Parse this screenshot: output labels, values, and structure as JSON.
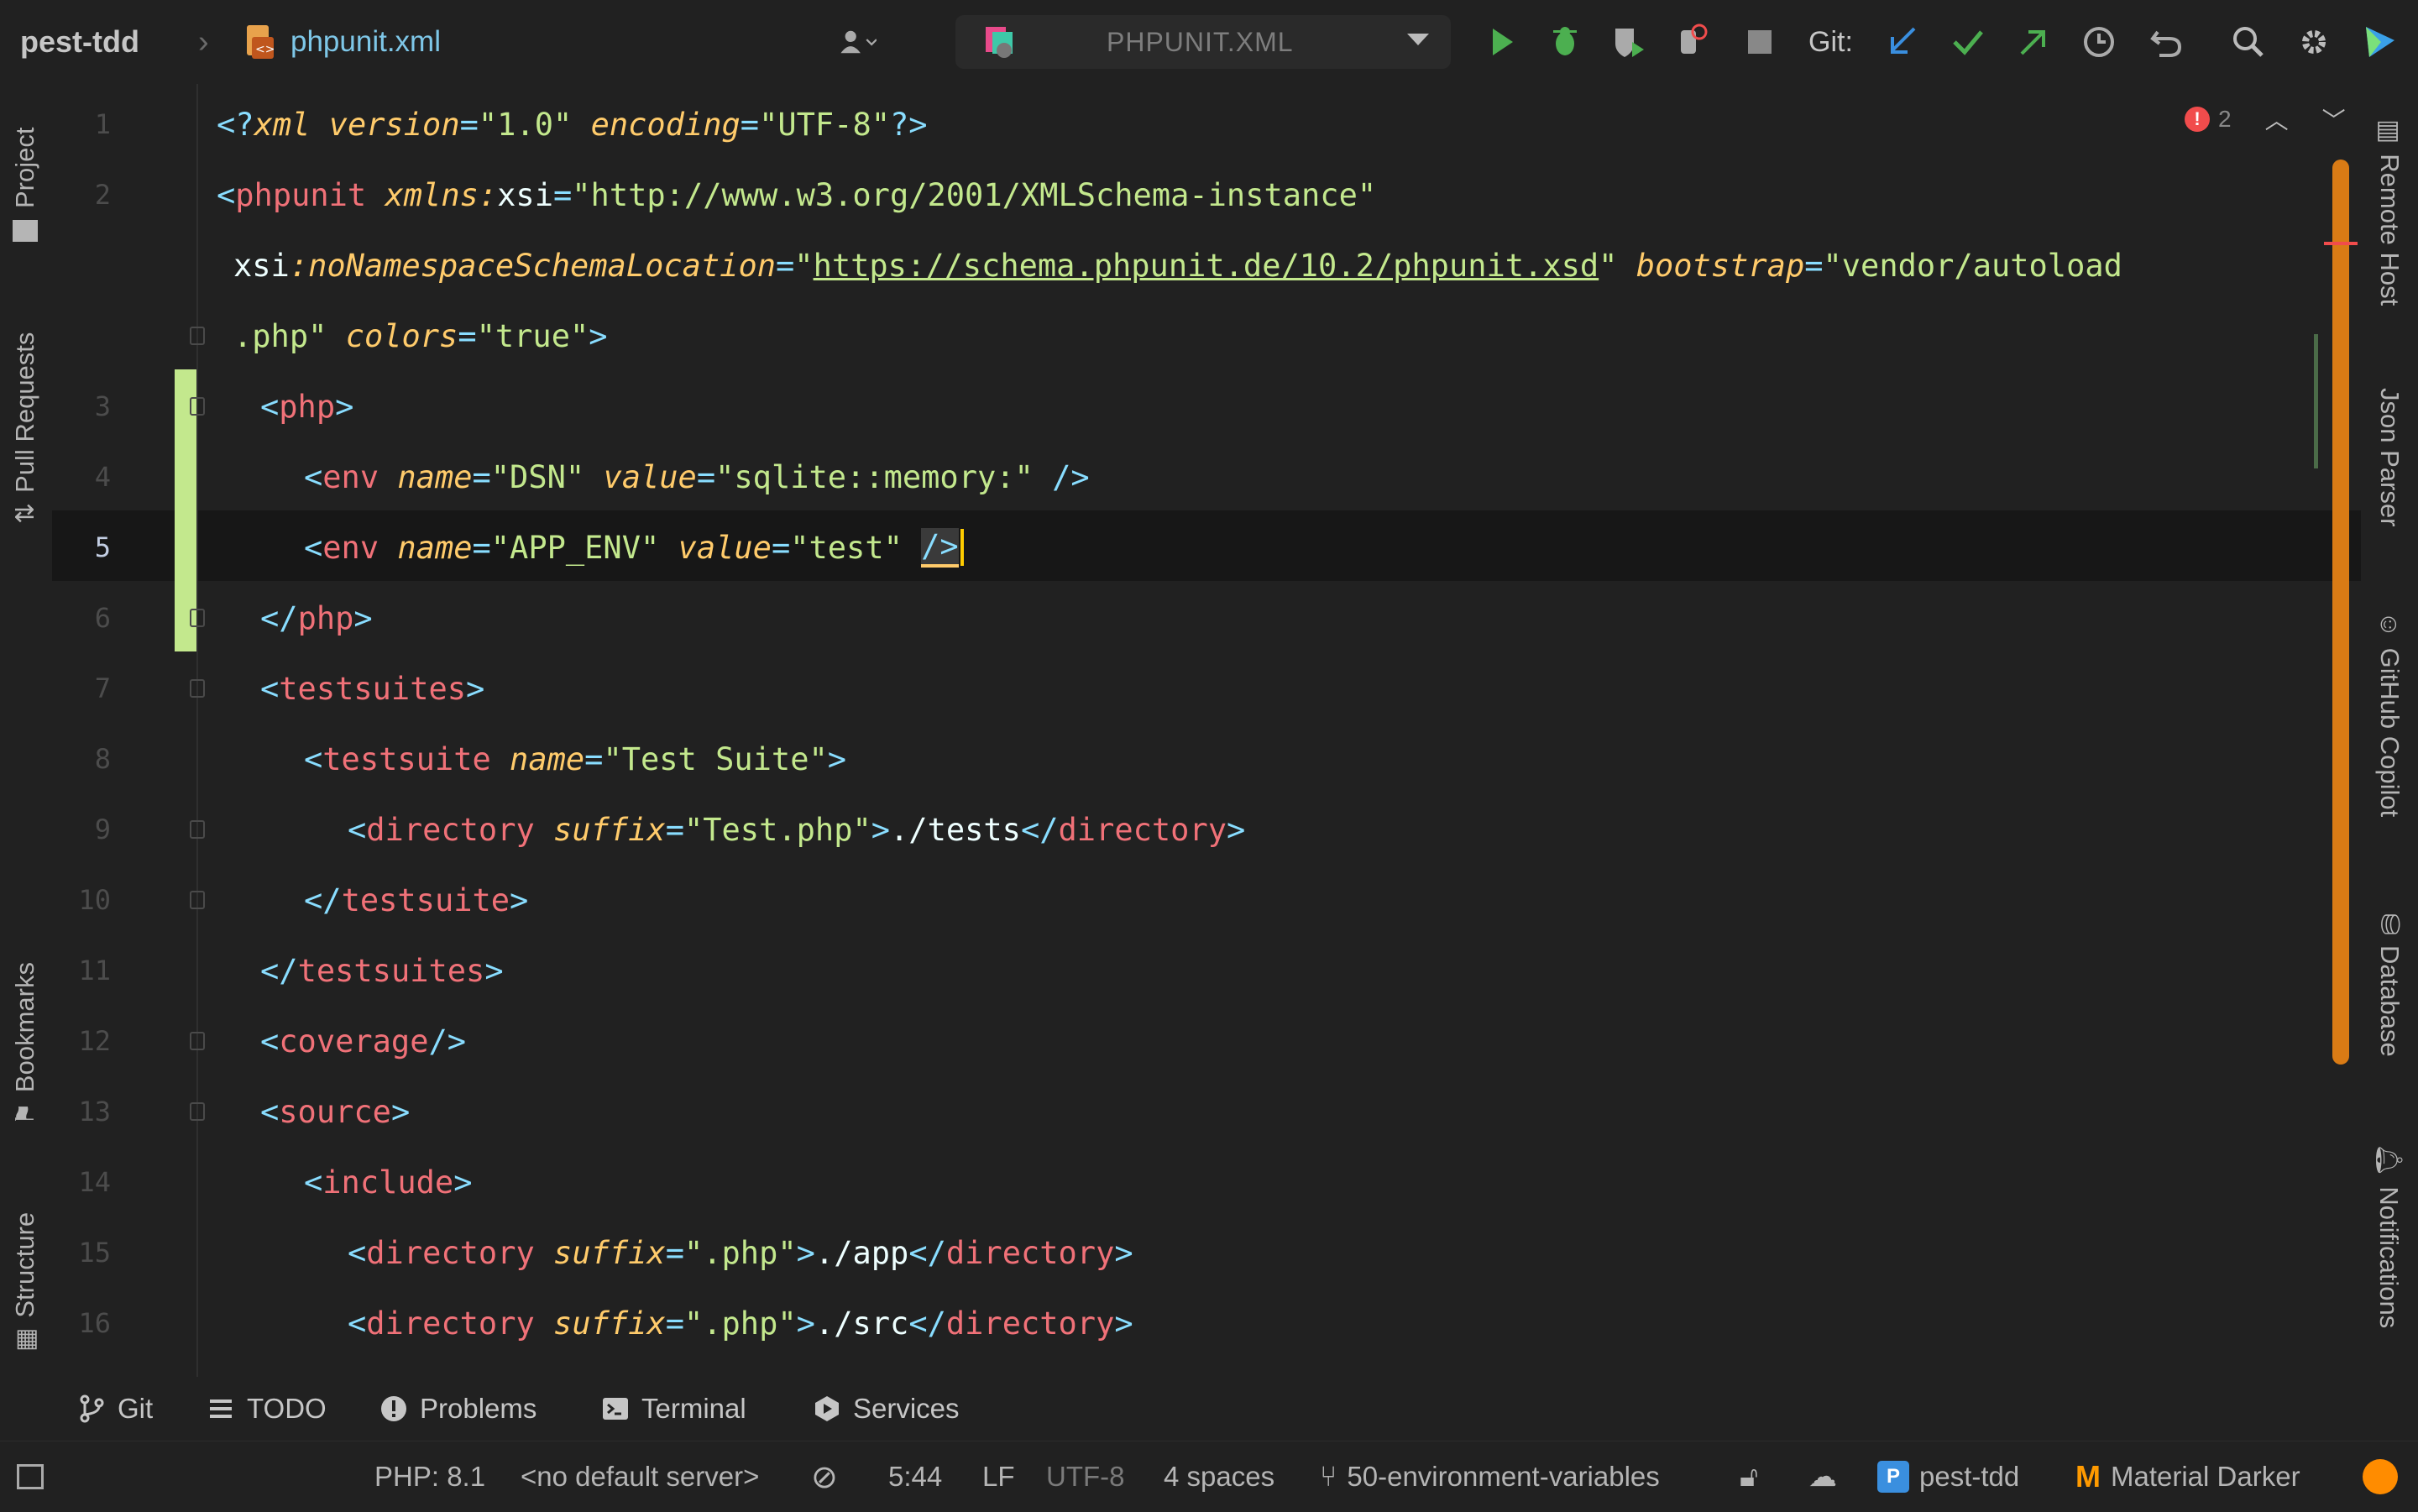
{
  "toolbar": {
    "project": "pest-tdd",
    "file": "phpunit.xml",
    "run_config": "PHPUNIT.XML",
    "git_label": "Git:"
  },
  "left_tools": [
    "Project",
    "Pull Requests",
    "Bookmarks",
    "Structure"
  ],
  "right_tools": [
    "Remote Host",
    "Json Parser",
    "GitHub Copilot",
    "Database",
    "Notifications"
  ],
  "editor": {
    "line_numbers": [
      "1",
      "2",
      "",
      "",
      "3",
      "4",
      "5",
      "6",
      "7",
      "8",
      "9",
      "10",
      "11",
      "12",
      "13",
      "14",
      "15",
      "16"
    ],
    "error_count": "2",
    "lines": [
      {
        "n": 1,
        "indent": 0,
        "tokens": [
          [
            "b",
            "<?"
          ],
          [
            "d",
            "xml"
          ],
          [
            "t",
            " "
          ],
          [
            "a",
            "version"
          ],
          [
            "e",
            "="
          ],
          [
            "s",
            "\"1.0\""
          ],
          [
            "t",
            " "
          ],
          [
            "a",
            "encoding"
          ],
          [
            "e",
            "="
          ],
          [
            "s",
            "\"UTF-8\""
          ],
          [
            "b",
            "?>"
          ]
        ]
      },
      {
        "n": 2,
        "indent": 0,
        "tokens": [
          [
            "b",
            "<"
          ],
          [
            "g",
            "phpunit"
          ],
          [
            "t",
            " "
          ],
          [
            "a",
            "xmlns:"
          ],
          [
            "t",
            "xsi"
          ],
          [
            "e",
            "="
          ],
          [
            "s",
            "\"http://www.w3.org/2001/XMLSchema-instance\""
          ]
        ]
      },
      {
        "n": "",
        "indent": 20,
        "tokens": [
          [
            "t",
            "xsi"
          ],
          [
            "a",
            ":noNamespaceSchemaLocation"
          ],
          [
            "e",
            "="
          ],
          [
            "s",
            "\""
          ],
          [
            "l",
            "https://schema.phpunit.de/10.2/phpunit.xsd"
          ],
          [
            "s",
            "\""
          ],
          [
            "t",
            " "
          ],
          [
            "a",
            "bootstrap"
          ],
          [
            "e",
            "="
          ],
          [
            "s",
            "\"vendor/autoload"
          ]
        ]
      },
      {
        "n": "",
        "indent": 20,
        "tokens": [
          [
            "s",
            ".php\""
          ],
          [
            "t",
            " "
          ],
          [
            "a",
            "colors"
          ],
          [
            "e",
            "="
          ],
          [
            "s",
            "\"true\""
          ],
          [
            "b",
            ">"
          ]
        ]
      },
      {
        "n": 3,
        "indent": 52,
        "tokens": [
          [
            "b",
            "<"
          ],
          [
            "g",
            "php"
          ],
          [
            "b",
            ">"
          ]
        ]
      },
      {
        "n": 4,
        "indent": 104,
        "tokens": [
          [
            "b",
            "<"
          ],
          [
            "g",
            "env"
          ],
          [
            "t",
            " "
          ],
          [
            "a",
            "name"
          ],
          [
            "e",
            "="
          ],
          [
            "s",
            "\"DSN\""
          ],
          [
            "t",
            " "
          ],
          [
            "a",
            "value"
          ],
          [
            "e",
            "="
          ],
          [
            "s",
            "\"sqlite::memory:\""
          ],
          [
            "t",
            " "
          ],
          [
            "b",
            "/>"
          ]
        ]
      },
      {
        "n": 5,
        "indent": 104,
        "tokens": [
          [
            "b",
            "<"
          ],
          [
            "g",
            "env"
          ],
          [
            "t",
            " "
          ],
          [
            "a",
            "name"
          ],
          [
            "e",
            "="
          ],
          [
            "s",
            "\"APP_ENV\""
          ],
          [
            "t",
            " "
          ],
          [
            "a",
            "value"
          ],
          [
            "e",
            "="
          ],
          [
            "s",
            "\"test\""
          ],
          [
            "t",
            " "
          ],
          [
            "h",
            "/>"
          ]
        ]
      },
      {
        "n": 6,
        "indent": 52,
        "tokens": [
          [
            "b",
            "</"
          ],
          [
            "g",
            "php"
          ],
          [
            "b",
            ">"
          ]
        ]
      },
      {
        "n": 7,
        "indent": 52,
        "tokens": [
          [
            "b",
            "<"
          ],
          [
            "g",
            "testsuites"
          ],
          [
            "b",
            ">"
          ]
        ]
      },
      {
        "n": 8,
        "indent": 104,
        "tokens": [
          [
            "b",
            "<"
          ],
          [
            "g",
            "testsuite"
          ],
          [
            "t",
            " "
          ],
          [
            "a",
            "name"
          ],
          [
            "e",
            "="
          ],
          [
            "s",
            "\"Test Suite\""
          ],
          [
            "b",
            ">"
          ]
        ]
      },
      {
        "n": 9,
        "indent": 156,
        "tokens": [
          [
            "b",
            "<"
          ],
          [
            "g",
            "directory"
          ],
          [
            "t",
            " "
          ],
          [
            "a",
            "suffix"
          ],
          [
            "e",
            "="
          ],
          [
            "s",
            "\"Test.php\""
          ],
          [
            "b",
            ">"
          ],
          [
            "t",
            "./tests"
          ],
          [
            "b",
            "</"
          ],
          [
            "g",
            "directory"
          ],
          [
            "b",
            ">"
          ]
        ]
      },
      {
        "n": 10,
        "indent": 104,
        "tokens": [
          [
            "b",
            "</"
          ],
          [
            "g",
            "testsuite"
          ],
          [
            "b",
            ">"
          ]
        ]
      },
      {
        "n": 11,
        "indent": 52,
        "tokens": [
          [
            "b",
            "</"
          ],
          [
            "g",
            "testsuites"
          ],
          [
            "b",
            ">"
          ]
        ]
      },
      {
        "n": 12,
        "indent": 52,
        "tokens": [
          [
            "b",
            "<"
          ],
          [
            "g",
            "coverage"
          ],
          [
            "b",
            "/>"
          ]
        ]
      },
      {
        "n": 13,
        "indent": 52,
        "tokens": [
          [
            "b",
            "<"
          ],
          [
            "g",
            "source"
          ],
          [
            "b",
            ">"
          ]
        ]
      },
      {
        "n": 14,
        "indent": 104,
        "tokens": [
          [
            "b",
            "<"
          ],
          [
            "g",
            "include"
          ],
          [
            "b",
            ">"
          ]
        ]
      },
      {
        "n": 15,
        "indent": 156,
        "tokens": [
          [
            "b",
            "<"
          ],
          [
            "g",
            "directory"
          ],
          [
            "t",
            " "
          ],
          [
            "a",
            "suffix"
          ],
          [
            "e",
            "="
          ],
          [
            "s",
            "\".php\""
          ],
          [
            "b",
            ">"
          ],
          [
            "t",
            "./app"
          ],
          [
            "b",
            "</"
          ],
          [
            "g",
            "directory"
          ],
          [
            "b",
            ">"
          ]
        ]
      },
      {
        "n": 16,
        "indent": 156,
        "tokens": [
          [
            "b",
            "<"
          ],
          [
            "g",
            "directory"
          ],
          [
            "t",
            " "
          ],
          [
            "a",
            "suffix"
          ],
          [
            "e",
            "="
          ],
          [
            "s",
            "\".php\""
          ],
          [
            "b",
            ">"
          ],
          [
            "t",
            "./src"
          ],
          [
            "b",
            "</"
          ],
          [
            "g",
            "directory"
          ],
          [
            "b",
            ">"
          ]
        ]
      }
    ]
  },
  "bottom_tabs": [
    "Git",
    "TODO",
    "Problems",
    "Terminal",
    "Services"
  ],
  "status": {
    "php": "PHP: 8.1",
    "server": "<no default server>",
    "position": "5:44",
    "line_sep": "LF",
    "encoding": "UTF-8",
    "indent": "4 spaces",
    "branch": "50-environment-variables",
    "project": "pest-tdd",
    "theme": "Material Darker"
  },
  "colors": {
    "accent": "#ff8c00",
    "tag": "#f07178",
    "attr": "#ffcb6b",
    "string": "#c3e88d",
    "bracket": "#89ddff"
  }
}
